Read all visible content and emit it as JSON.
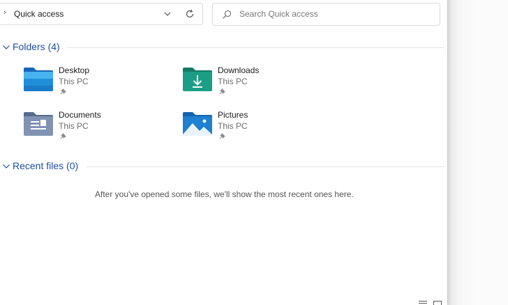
{
  "address_bar": {
    "path": "Quick access"
  },
  "search": {
    "placeholder": "Search Quick access"
  },
  "sections": {
    "folders": {
      "title": "Folders (4)",
      "items": [
        {
          "name": "Desktop",
          "location": "This PC",
          "icon": "desktop-folder-icon"
        },
        {
          "name": "Downloads",
          "location": "This PC",
          "icon": "downloads-folder-icon"
        },
        {
          "name": "Documents",
          "location": "This PC",
          "icon": "documents-folder-icon"
        },
        {
          "name": "Pictures",
          "location": "This PC",
          "icon": "pictures-folder-icon"
        }
      ]
    },
    "recent": {
      "title": "Recent files (0)",
      "empty_message": "After you've opened some files, we'll show the most recent ones here."
    }
  },
  "colors": {
    "section_title": "#1d4fa0",
    "desktop_folder": "#1e8fd8",
    "downloads_folder": "#1b9e85",
    "documents_folder": "#6f86a8",
    "pictures_folder": "#1f7fd0"
  }
}
